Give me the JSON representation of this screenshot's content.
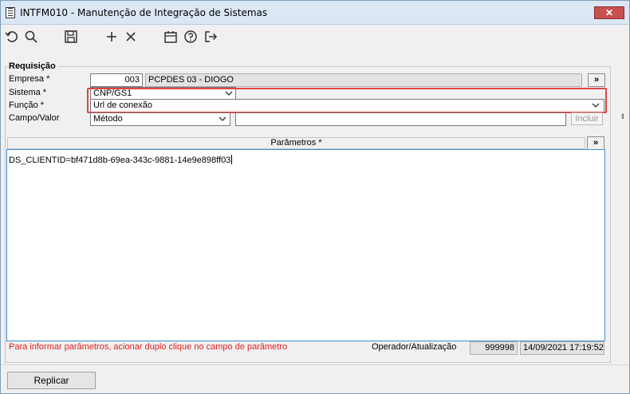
{
  "window": {
    "title": "INTFM010 - Manutenção de Integração de Sistemas",
    "close_label": "✕"
  },
  "toolbar": {
    "icons": [
      "undo-icon",
      "search-icon",
      "save-icon",
      "add-icon",
      "delete-icon",
      "calendar-icon",
      "help-icon",
      "exit-icon"
    ]
  },
  "form": {
    "group_title": "Requisição",
    "empresa": {
      "label": "Empresa *",
      "code": "003",
      "name": "PCPDES 03 - DIOGO",
      "expand_label": "»"
    },
    "sistema": {
      "label": "Sistema *",
      "value": "CNP/GS1"
    },
    "funcao": {
      "label": "Função *",
      "value": "Url de conexão"
    },
    "campo_valor": {
      "label": "Campo/Valor",
      "select_value": "Método",
      "text_value": "",
      "incluir_label": "Incluir"
    }
  },
  "parameters": {
    "header": "Parâmetros *",
    "expand_label": "»",
    "content": "DS_CLIENTID=bf471d8b-69ea-343c-9881-14e9e898ff03"
  },
  "status": {
    "hint": "Para informar parâmetros, acionar duplo clique no campo de parâmetro",
    "operator_label": "Operador/Atualização",
    "operator_id": "999998",
    "timestamp": "14/09/2021 17:19:52"
  },
  "footer": {
    "replicar_label": "Replicar"
  },
  "colors": {
    "highlight": "#e04545",
    "hint_text": "#e02020",
    "focus_border": "#3c8dd8"
  }
}
